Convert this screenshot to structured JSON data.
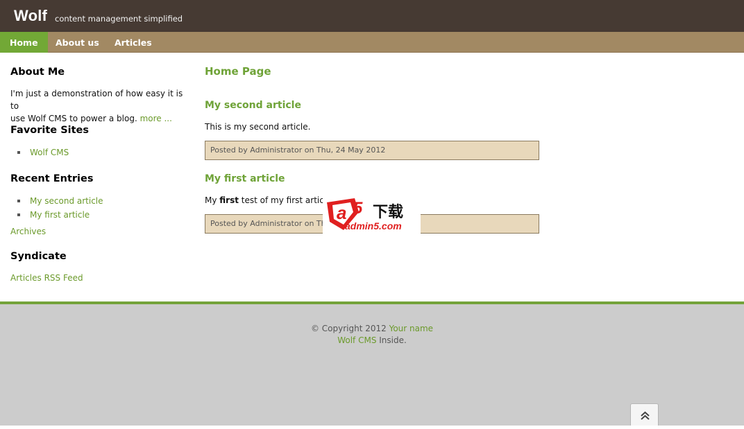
{
  "header": {
    "brand": "Wolf",
    "tagline": "content management simplified"
  },
  "nav": {
    "items": [
      {
        "label": "Home",
        "active": true
      },
      {
        "label": "About us",
        "active": false
      },
      {
        "label": "Articles",
        "active": false
      }
    ]
  },
  "sidebar": {
    "about": {
      "heading": "About Me",
      "text_line1": "I'm just a demonstration of how easy it is to",
      "text_line2": "use Wolf CMS to power a blog.",
      "more_link": "more ..."
    },
    "favorites": {
      "heading": "Favorite Sites",
      "items": [
        "Wolf CMS"
      ]
    },
    "recent": {
      "heading": "Recent Entries",
      "items": [
        "My second article",
        "My first article"
      ],
      "archives_link": "Archives"
    },
    "syndicate": {
      "heading": "Syndicate",
      "rss_link": "Articles RSS Feed"
    }
  },
  "main": {
    "page_title": "Home Page",
    "articles": [
      {
        "title": "My second article",
        "body": "This is my second article.",
        "info": "Posted by Administrator on Thu, 24 May 2012"
      },
      {
        "title": "My first article",
        "body_prefix": "My ",
        "body_bold": "first",
        "body_suffix": " test of my first article",
        "info": "Posted by Administrator on Th"
      }
    ]
  },
  "watermark": {
    "brand_text": "下载",
    "site": "admin5.com"
  },
  "footer": {
    "copyright_prefix": "© Copyright 2012 ",
    "your_name": "Your name",
    "wolf_link": "Wolf CMS",
    "inside": " Inside."
  },
  "colors": {
    "header_bg": "#463a33",
    "nav_bg": "#a28963",
    "nav_active": "#72a836",
    "link": "#6b9a2b",
    "postinfo_bg": "#e8d8bb",
    "footer_bg": "#cccccc"
  },
  "icons": {
    "scroll_top": "double-chevron-up-icon"
  }
}
